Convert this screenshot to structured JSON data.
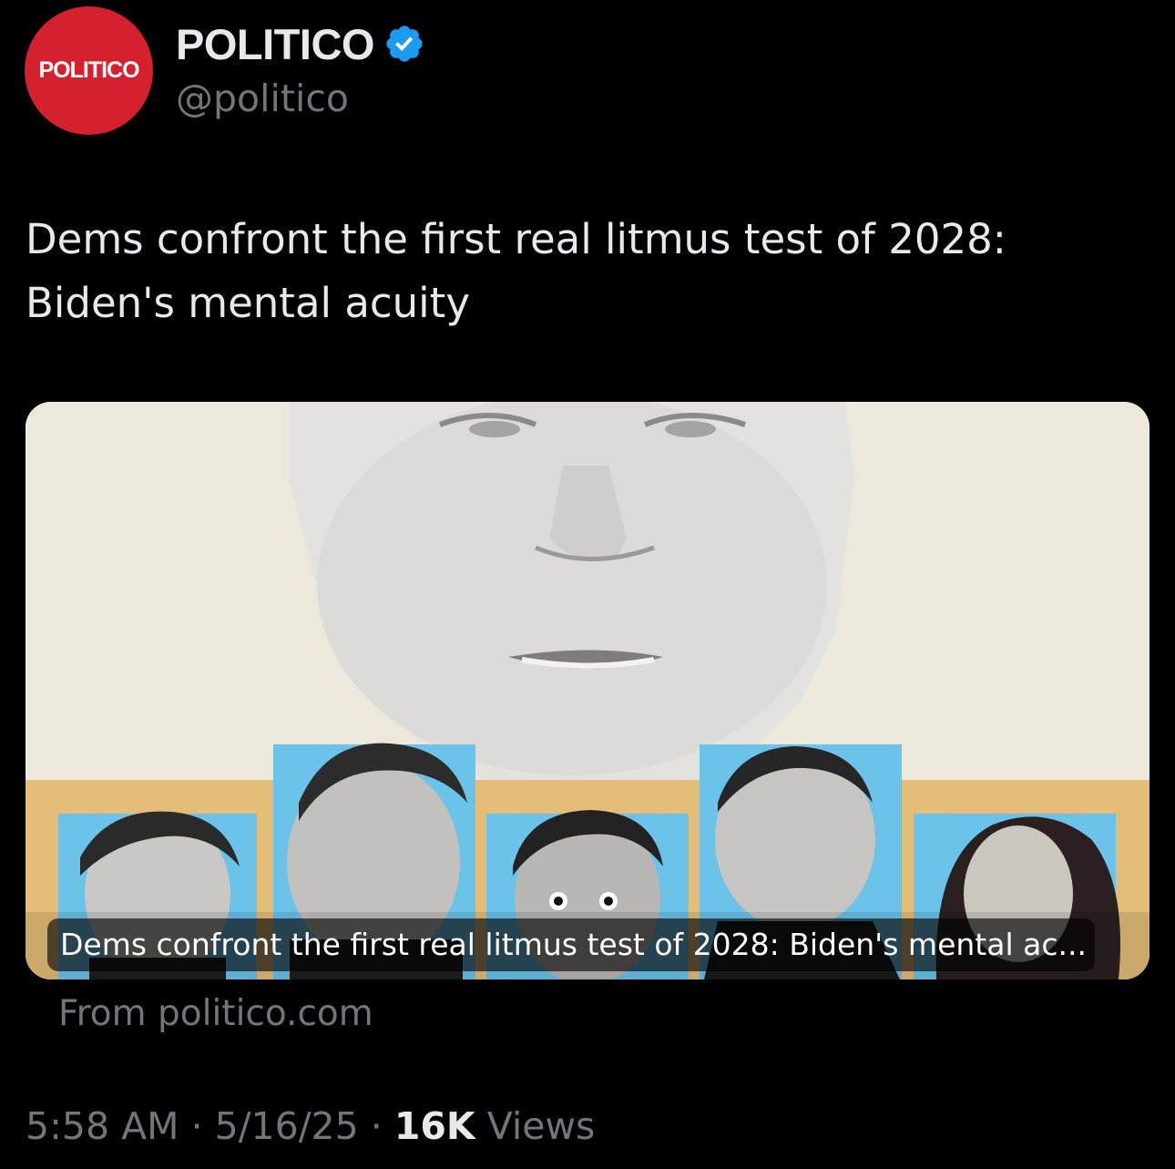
{
  "account": {
    "avatar_text": "POLITICO",
    "display_name": "POLITICO",
    "handle": "@politico",
    "verified": true
  },
  "tweet": {
    "text": "Dems confront the first real litmus test of 2028:\nBiden's mental acuity"
  },
  "link_card": {
    "title": "Dems confront the first real litmus test of 2028: Biden's mental ac...",
    "source": "From politico.com"
  },
  "meta": {
    "time": "5:58 AM",
    "separator": " · ",
    "date": "5/16/25",
    "views_count": "16K",
    "views_label": "Views"
  },
  "colors": {
    "background": "#000000",
    "text_primary": "#e7e9ea",
    "text_secondary": "#71767b",
    "avatar_red": "#d5202d",
    "verified_blue": "#1d9bf0",
    "card_cream": "#ece8dc",
    "panel_blue": "#6bc3ea",
    "band_tan": "#e4bd78"
  },
  "icons": {
    "verified": "verified-badge-icon"
  }
}
